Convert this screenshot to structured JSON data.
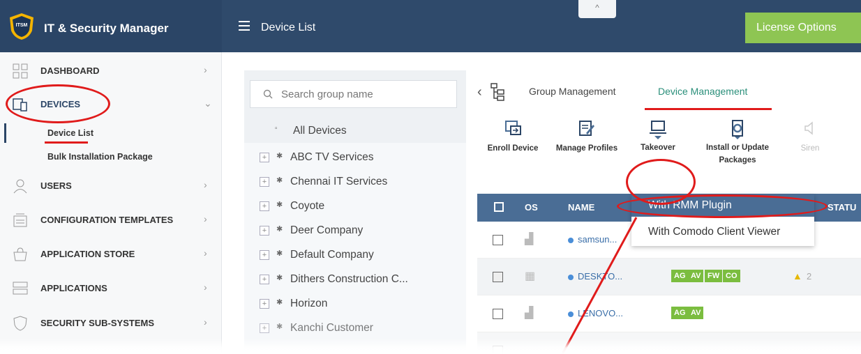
{
  "header": {
    "logo_text": "ITSM",
    "app_title": "IT & Security Manager",
    "page_title": "Device List",
    "collapse_glyph": "^",
    "license_button": "License Options"
  },
  "sidebar": {
    "items": [
      {
        "label": "DASHBOARD",
        "icon": "dashboard-icon"
      },
      {
        "label": "DEVICES",
        "icon": "devices-icon"
      },
      {
        "label": "USERS",
        "icon": "user-icon"
      },
      {
        "label": "CONFIGURATION TEMPLATES",
        "icon": "templates-icon"
      },
      {
        "label": "APPLICATION STORE",
        "icon": "store-icon"
      },
      {
        "label": "APPLICATIONS",
        "icon": "applications-icon"
      },
      {
        "label": "SECURITY SUB-SYSTEMS",
        "icon": "shield-icon"
      }
    ],
    "subitems": [
      {
        "label": "Device List"
      },
      {
        "label": "Bulk Installation Package"
      }
    ]
  },
  "groups": {
    "search_placeholder": "Search group name",
    "all_devices": "All Devices",
    "list": [
      "ABC TV Services",
      "Chennai IT Services",
      "Coyote",
      "Deer Company",
      "Default Company",
      "Dithers Construction C...",
      "Horizon",
      "Kanchi Customer"
    ]
  },
  "tabs": {
    "group_management": "Group Management",
    "device_management": "Device Management"
  },
  "toolbar": {
    "enroll": "Enroll Device",
    "manage_profiles": "Manage Profiles",
    "takeover": "Takeover",
    "install_line1": "Install or Update",
    "install_line2": "Packages",
    "siren": "Siren"
  },
  "table": {
    "headers": {
      "os": "OS",
      "name": "NAME",
      "status": "STATU"
    },
    "rows": [
      {
        "name": "samsun...",
        "badges": []
      },
      {
        "name": "DESKTO...",
        "badges": [
          "AG",
          "AV",
          "FW",
          "CO"
        ],
        "warning": "2"
      },
      {
        "name": "LENOVO...",
        "badges": [
          "AG",
          "AV"
        ]
      }
    ]
  },
  "takeover_menu": {
    "options": [
      "With RMM Plugin",
      "With Comodo Client Viewer"
    ]
  },
  "colors": {
    "topbar": "#2f4a6b",
    "accent": "#4a6d95",
    "license": "#8ec553",
    "highlight": "#e01b1b",
    "active_tab": "#2a8f7a"
  }
}
